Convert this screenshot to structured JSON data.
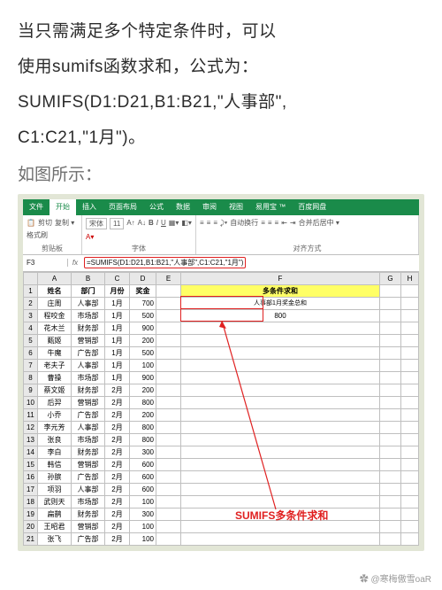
{
  "intro_line1": "当只需满足多个特定条件时，可以",
  "intro_line2": "使用sumifs函数求和，公式为：",
  "intro_line3": "SUMIFS(D1:D21,B1:B21,\"人事部\",",
  "intro_line4": "C1:C21,\"1月\")。",
  "lead": "如图所示：",
  "excel": {
    "tabs": {
      "file": "文件",
      "home": "开始",
      "insert": "插入",
      "layout": "页面布局",
      "formulas": "公式",
      "data": "数据",
      "review": "审阅",
      "view": "视图",
      "ez": "易用宝 ™",
      "baidu": "百度网盘"
    },
    "ribbon": {
      "clipboard": {
        "paste": "粘贴",
        "cut": "剪切",
        "copy": "复制 ▾",
        "brush": "格式刷",
        "label": "剪贴板"
      },
      "font": {
        "name": "宋体",
        "size": "11",
        "label": "字体",
        "bold": "B",
        "italic": "I",
        "under": "U"
      },
      "align": {
        "wrap": "自动换行",
        "merge": "合并后居中 ▾",
        "label": "对齐方式"
      }
    },
    "namebox": "F3",
    "fx": "fx",
    "formula": "=SUMIFS(D1:D21,B1:B21,\"人事部\",C1:C21,\"1月\")",
    "cols": [
      "",
      "A",
      "B",
      "C",
      "D",
      "E",
      "F",
      "G",
      "H"
    ],
    "header_row": {
      "A": "姓名",
      "B": "部门",
      "C": "月份",
      "D": "奖金",
      "F": "多条件求和"
    },
    "result_label": "人事部1月奖金总和",
    "result_value": "800",
    "rows": [
      {
        "n": "2",
        "A": "庄周",
        "B": "人事部",
        "C": "1月",
        "D": "700"
      },
      {
        "n": "3",
        "A": "程咬金",
        "B": "市场部",
        "C": "1月",
        "D": "500"
      },
      {
        "n": "4",
        "A": "花木兰",
        "B": "财务部",
        "C": "1月",
        "D": "900"
      },
      {
        "n": "5",
        "A": "甄姬",
        "B": "营销部",
        "C": "1月",
        "D": "200"
      },
      {
        "n": "6",
        "A": "牛魔",
        "B": "广告部",
        "C": "1月",
        "D": "500"
      },
      {
        "n": "7",
        "A": "老夫子",
        "B": "人事部",
        "C": "1月",
        "D": "100"
      },
      {
        "n": "8",
        "A": "曹操",
        "B": "市场部",
        "C": "1月",
        "D": "900"
      },
      {
        "n": "9",
        "A": "蔡文姬",
        "B": "财务部",
        "C": "2月",
        "D": "200"
      },
      {
        "n": "10",
        "A": "后羿",
        "B": "营销部",
        "C": "2月",
        "D": "800"
      },
      {
        "n": "11",
        "A": "小乔",
        "B": "广告部",
        "C": "2月",
        "D": "200"
      },
      {
        "n": "12",
        "A": "李元芳",
        "B": "人事部",
        "C": "2月",
        "D": "800"
      },
      {
        "n": "13",
        "A": "张良",
        "B": "市场部",
        "C": "2月",
        "D": "800"
      },
      {
        "n": "14",
        "A": "李白",
        "B": "财务部",
        "C": "2月",
        "D": "300"
      },
      {
        "n": "15",
        "A": "韩信",
        "B": "营销部",
        "C": "2月",
        "D": "600"
      },
      {
        "n": "16",
        "A": "孙膑",
        "B": "广告部",
        "C": "2月",
        "D": "600"
      },
      {
        "n": "17",
        "A": "项羽",
        "B": "人事部",
        "C": "2月",
        "D": "600"
      },
      {
        "n": "18",
        "A": "武则天",
        "B": "市场部",
        "C": "2月",
        "D": "100"
      },
      {
        "n": "19",
        "A": "扁鹊",
        "B": "财务部",
        "C": "2月",
        "D": "300"
      },
      {
        "n": "20",
        "A": "王昭君",
        "B": "营销部",
        "C": "2月",
        "D": "100"
      },
      {
        "n": "21",
        "A": "张飞",
        "B": "广告部",
        "C": "2月",
        "D": "100"
      }
    ],
    "callout": "SUMIFS多条件求和"
  },
  "watermark": "✿ @寒梅傲雪oaR"
}
